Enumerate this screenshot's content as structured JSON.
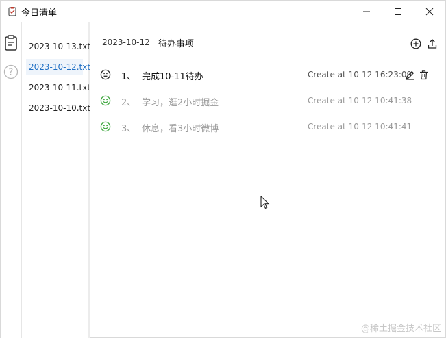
{
  "app": {
    "title": "今日清单"
  },
  "colors": {
    "accent": "#1f6fc4",
    "done_icon": "#3aa63a",
    "text": "#111111",
    "muted": "#9a9a9a"
  },
  "rail": {
    "icons": [
      "clipboard-icon",
      "help-icon"
    ]
  },
  "files": [
    {
      "name": "2023-10-13.txt",
      "active": false
    },
    {
      "name": "2023-10-12.txt",
      "active": true
    },
    {
      "name": "2023-10-11.txt",
      "active": false
    },
    {
      "name": "2023-10-10.txt",
      "active": false
    }
  ],
  "main": {
    "date": "2023-10-12",
    "title": "待办事项",
    "todos": [
      {
        "num": "1、",
        "text": "完成10-11待办",
        "time": "Create at 10-12 16:23:09",
        "done": false
      },
      {
        "num": "2、",
        "text": "学习，逛2小时掘金",
        "time": "Create at 10-12 10:41:38",
        "done": true
      },
      {
        "num": "3、",
        "text": "休息，看3小时微博",
        "time": "Create at 10-12 10:41:41",
        "done": true
      }
    ]
  },
  "watermark": "@稀土掘金技术社区"
}
